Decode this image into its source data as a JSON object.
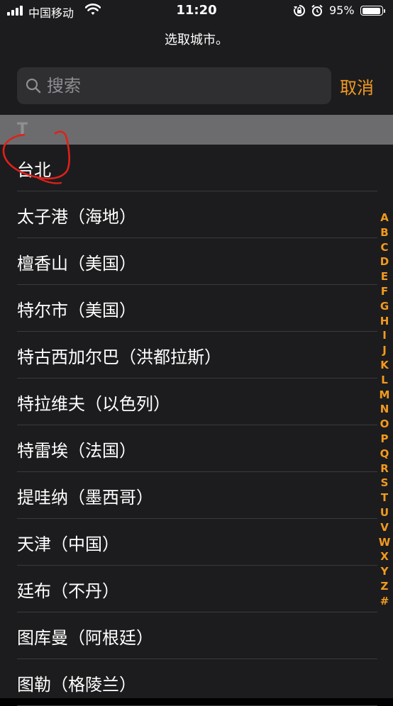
{
  "status_bar": {
    "carrier": "中国移动",
    "time": "11:20",
    "battery": "95%",
    "battery_level": 0.95
  },
  "header": {
    "prompt": "选取城市。",
    "search_placeholder": "搜索",
    "cancel_label": "取消"
  },
  "section": {
    "letter": "T"
  },
  "cities": [
    "台北",
    "太子港（海地）",
    "檀香山（美国）",
    "特尔市（美国）",
    "特古西加尔巴（洪都拉斯）",
    "特拉维夫（以色列）",
    "特雷埃（法国）",
    "提哇纳（墨西哥）",
    "天津（中国）",
    "廷布（不丹）",
    "图库曼（阿根廷）",
    "图勒（格陵兰）"
  ],
  "index_letters": [
    "A",
    "B",
    "C",
    "D",
    "E",
    "F",
    "G",
    "H",
    "I",
    "J",
    "K",
    "L",
    "M",
    "N",
    "O",
    "P",
    "Q",
    "R",
    "S",
    "T",
    "U",
    "V",
    "W",
    "X",
    "Y",
    "Z",
    "#"
  ],
  "colors": {
    "accent": "#f39a1e",
    "background": "#1c1c1e",
    "section_header": "#6c6c6e",
    "annotation": "#e0201a"
  },
  "icons": {
    "signal": "cellular-signal-icon",
    "wifi": "wifi-icon",
    "rotation_lock": "rotation-lock-icon",
    "alarm": "alarm-icon",
    "battery": "battery-icon",
    "search": "search-icon"
  }
}
